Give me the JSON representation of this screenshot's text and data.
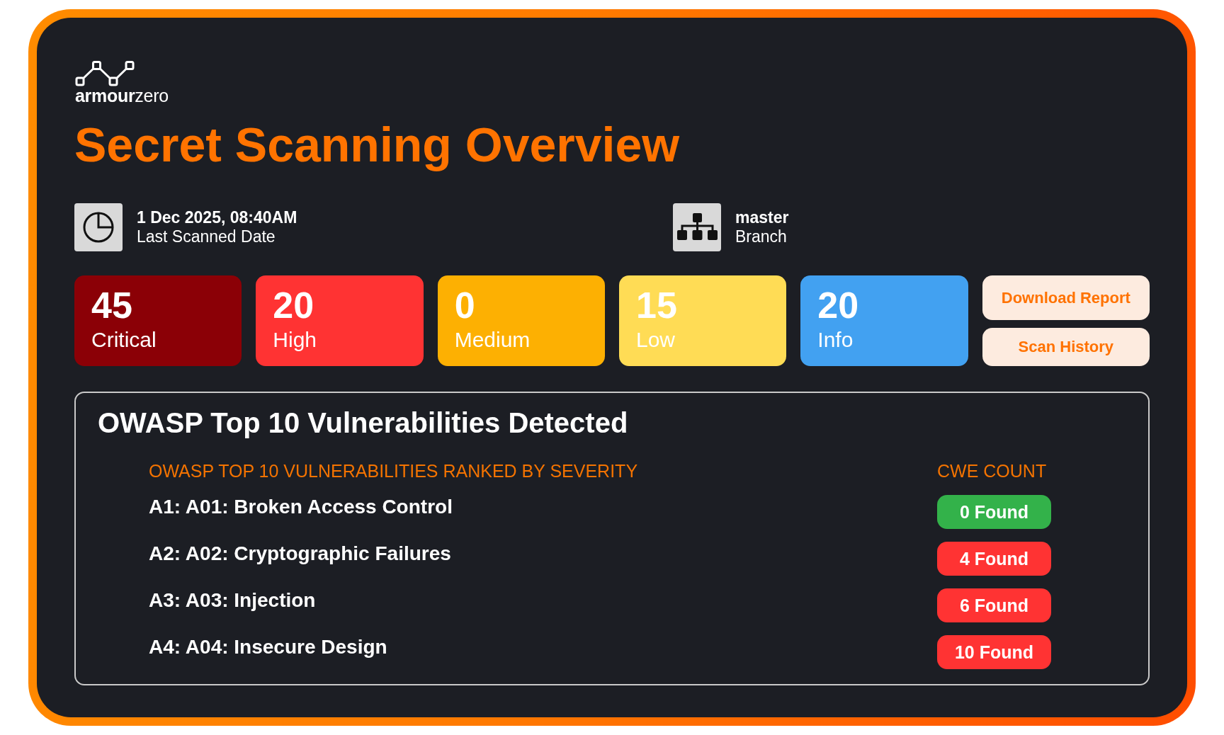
{
  "brand": {
    "logo_text": "**armour**zero"
  },
  "title": "Secret Scanning Overview",
  "scan_info": [
    {
      "kind": "date",
      "value": "1 Dec 2025, 08:40AM",
      "label": "Last Scanned Date"
    },
    {
      "kind": "branch",
      "value": "master",
      "label": "Branch"
    }
  ],
  "severity_cards": [
    {
      "count": "45",
      "label": "Critical",
      "color": "#8b0006"
    },
    {
      "count": "20",
      "label": "High",
      "color": "#ff3333"
    },
    {
      "count": "0",
      "label": "Medium",
      "color": "#fdb002"
    },
    {
      "count": "15",
      "label": "Low",
      "color": "#ffdc55"
    },
    {
      "count": "20",
      "label": "Info",
      "color": "#42a1f1"
    }
  ],
  "actions": [
    {
      "label": "Download Report"
    },
    {
      "label": "Scan History"
    }
  ],
  "owasp_panel": {
    "title": "OWASP Top 10 Vulnerabilities Detected",
    "columns": [
      "OWASP TOP 10 VULNERABILITIES RANKED BY SEVERITY",
      "CWE COUNT"
    ],
    "rows": [
      {
        "name": "A1: A01: Broken Access Control",
        "count": "0 Found",
        "color": "#33b24a"
      },
      {
        "name": "A2: A02: Cryptographic Failures",
        "count": "4 Found",
        "color": "#ff3333"
      },
      {
        "name": "A3: A03: Injection",
        "count": "6 Found",
        "color": "#ff3333"
      },
      {
        "name": "A4: A04: Insecure Design",
        "count": "10 Found",
        "color": "#ff3333"
      }
    ]
  }
}
